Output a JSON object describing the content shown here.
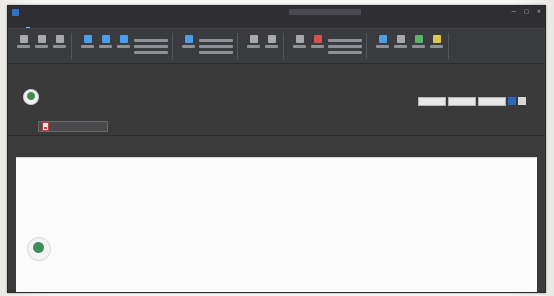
{
  "window": {
    "title": "",
    "controls": [
      "—",
      "□",
      "×"
    ]
  },
  "menu": {
    "items": [
      "",
      "",
      ""
    ]
  },
  "message": {
    "subject": "",
    "sender_name": "",
    "sender_detail": "",
    "meta": "",
    "attachment": ""
  },
  "actions": {
    "reply": "",
    "reply_all": "",
    "forward": ""
  },
  "body": {
    "lines": [
      "",
      "",
      "",
      "",
      "",
      "",
      ""
    ]
  },
  "signature": {
    "name": "",
    "title": "",
    "phone": "",
    "web": "",
    "email": ""
  },
  "disclaimer": ""
}
